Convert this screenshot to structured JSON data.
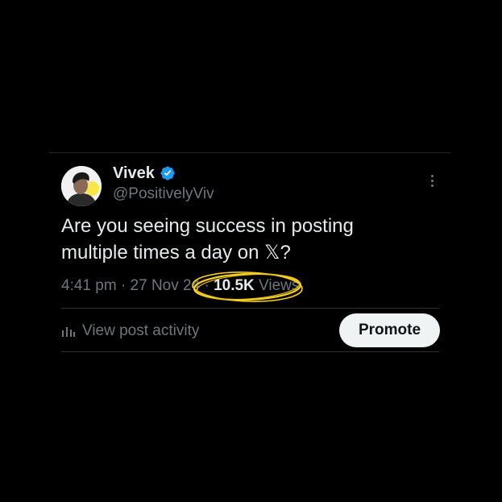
{
  "tweet": {
    "author": {
      "display_name": "Vivek",
      "handle": "@PositivelyViv",
      "verified_badge": "verified-icon"
    },
    "text_line1": "Are you seeing success in posting",
    "text_line2": "multiple times a day on 𝕏?",
    "time": "4:41 pm",
    "separator": " · ",
    "date": "27 Nov 24",
    "views_count": "10.5K",
    "views_label": " Views",
    "view_activity_label": "View post activity",
    "promote_label": "Promote"
  },
  "colors": {
    "background": "#000000",
    "primary_text": "#e7e9ea",
    "secondary_text": "#71767b",
    "verified_blue": "#1d9bf0",
    "highlight_yellow": "#f5d020",
    "promote_bg": "#eff3f4"
  }
}
